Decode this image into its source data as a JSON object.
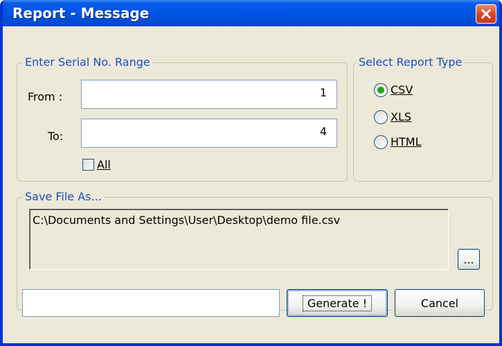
{
  "window": {
    "title": "Report - Message",
    "close_icon": "close-icon"
  },
  "serial_range": {
    "group_label": "Enter Serial No. Range",
    "from_label": "From :",
    "from_value": "1",
    "to_label": "To:",
    "to_value": "4",
    "all_label": "All",
    "all_checked": false
  },
  "report_type": {
    "group_label": "Select Report Type",
    "options": [
      {
        "label": "CSV",
        "selected": true
      },
      {
        "label": "XLS",
        "selected": false
      },
      {
        "label": "HTML",
        "selected": false
      }
    ]
  },
  "save_file": {
    "group_label": "Save File As...",
    "path": "C:\\Documents and Settings\\User\\Desktop\\demo file.csv",
    "browse_label": "..."
  },
  "footer": {
    "status_value": "",
    "generate_label": "Generate !",
    "cancel_label": "Cancel"
  },
  "colors": {
    "title_bar": "#0056e6",
    "group_label": "#1d4fbf",
    "radio_selected": "#21a121",
    "close_button": "#d5461f"
  }
}
